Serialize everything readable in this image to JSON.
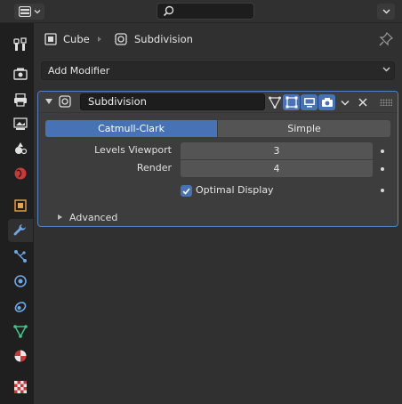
{
  "header": {
    "editor_type_icon": "properties-editor-icon",
    "search_icon": "search-icon",
    "search_value": "",
    "options_icon": "chevron-down-icon"
  },
  "tabs": [
    {
      "id": "tool",
      "icon": "tool-icon",
      "active": false
    },
    {
      "id": "render",
      "icon": "render-icon",
      "active": false
    },
    {
      "id": "output",
      "icon": "output-icon",
      "active": false
    },
    {
      "id": "view-layer",
      "icon": "view-layer-icon",
      "active": false
    },
    {
      "id": "scene",
      "icon": "scene-icon",
      "active": false
    },
    {
      "id": "world",
      "icon": "world-icon",
      "active": false
    },
    {
      "id": "object",
      "icon": "object-icon",
      "active": false
    },
    {
      "id": "modifiers",
      "icon": "wrench-icon",
      "active": true
    },
    {
      "id": "particles",
      "icon": "particles-icon",
      "active": false
    },
    {
      "id": "physics",
      "icon": "physics-icon",
      "active": false
    },
    {
      "id": "constraints",
      "icon": "constraints-icon",
      "active": false
    },
    {
      "id": "data",
      "icon": "mesh-data-icon",
      "active": false
    },
    {
      "id": "material",
      "icon": "material-icon",
      "active": false
    },
    {
      "id": "texture",
      "icon": "texture-icon",
      "active": false
    }
  ],
  "breadcrumb": {
    "object": "Cube",
    "modifier": "Subdivision"
  },
  "add_modifier": {
    "label": "Add Modifier"
  },
  "modifier": {
    "name": "Subdivision",
    "expanded": true,
    "toggles": {
      "on_cage": false,
      "edit_mode": true,
      "realtime": true,
      "render": true
    },
    "mode_options": [
      "Catmull-Clark",
      "Simple"
    ],
    "mode_selected": "Catmull-Clark",
    "levels_viewport_label": "Levels Viewport",
    "levels_viewport": "3",
    "render_label": "Render",
    "render_levels": "4",
    "optimal_display_label": "Optimal Display",
    "optimal_display": true,
    "advanced_label": "Advanced"
  },
  "colors": {
    "accent": "#4772b3",
    "background": "#303030",
    "panel": "#3d3d3d",
    "field": "#545454",
    "tab_strip": "#1f1f1f"
  }
}
